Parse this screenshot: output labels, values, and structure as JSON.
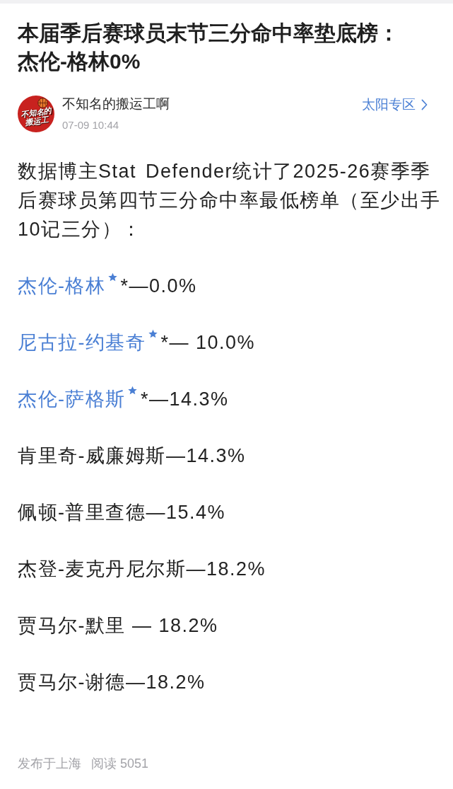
{
  "article": {
    "title": "本届季后赛球员末节三分命中率垫底榜：杰伦-格林0%"
  },
  "author": {
    "name": "不知名的搬运工啊",
    "avatar_text": [
      "不知名的",
      "搬运工"
    ],
    "time": "07-09 10:44"
  },
  "topic_link": {
    "label": "太阳专区"
  },
  "body": {
    "intro": "数据博主Stat Defender统计了2025-26赛季季后赛球员第四节三分命中率最低榜单（至少出手10记三分）：",
    "items": [
      {
        "kind": "linked",
        "name": "杰伦-格林",
        "rest": "*—0.0%"
      },
      {
        "kind": "linked",
        "name": "尼古拉-约基奇",
        "rest": "*— 10.0%"
      },
      {
        "kind": "linked",
        "name": "杰伦-萨格斯",
        "rest": "*—14.3%"
      },
      {
        "kind": "plain",
        "text": "肯里奇-威廉姆斯—14.3%"
      },
      {
        "kind": "plain",
        "text": "佩顿-普里查德—15.4%"
      },
      {
        "kind": "plain",
        "text": "杰登-麦克丹尼尔斯—18.2%"
      },
      {
        "kind": "plain",
        "text": "贾马尔-默里 — 18.2%"
      },
      {
        "kind": "plain",
        "text": "贾马尔-谢德—18.2%"
      }
    ]
  },
  "footer": {
    "location": "发布于上海",
    "reads": "阅读 5051"
  }
}
